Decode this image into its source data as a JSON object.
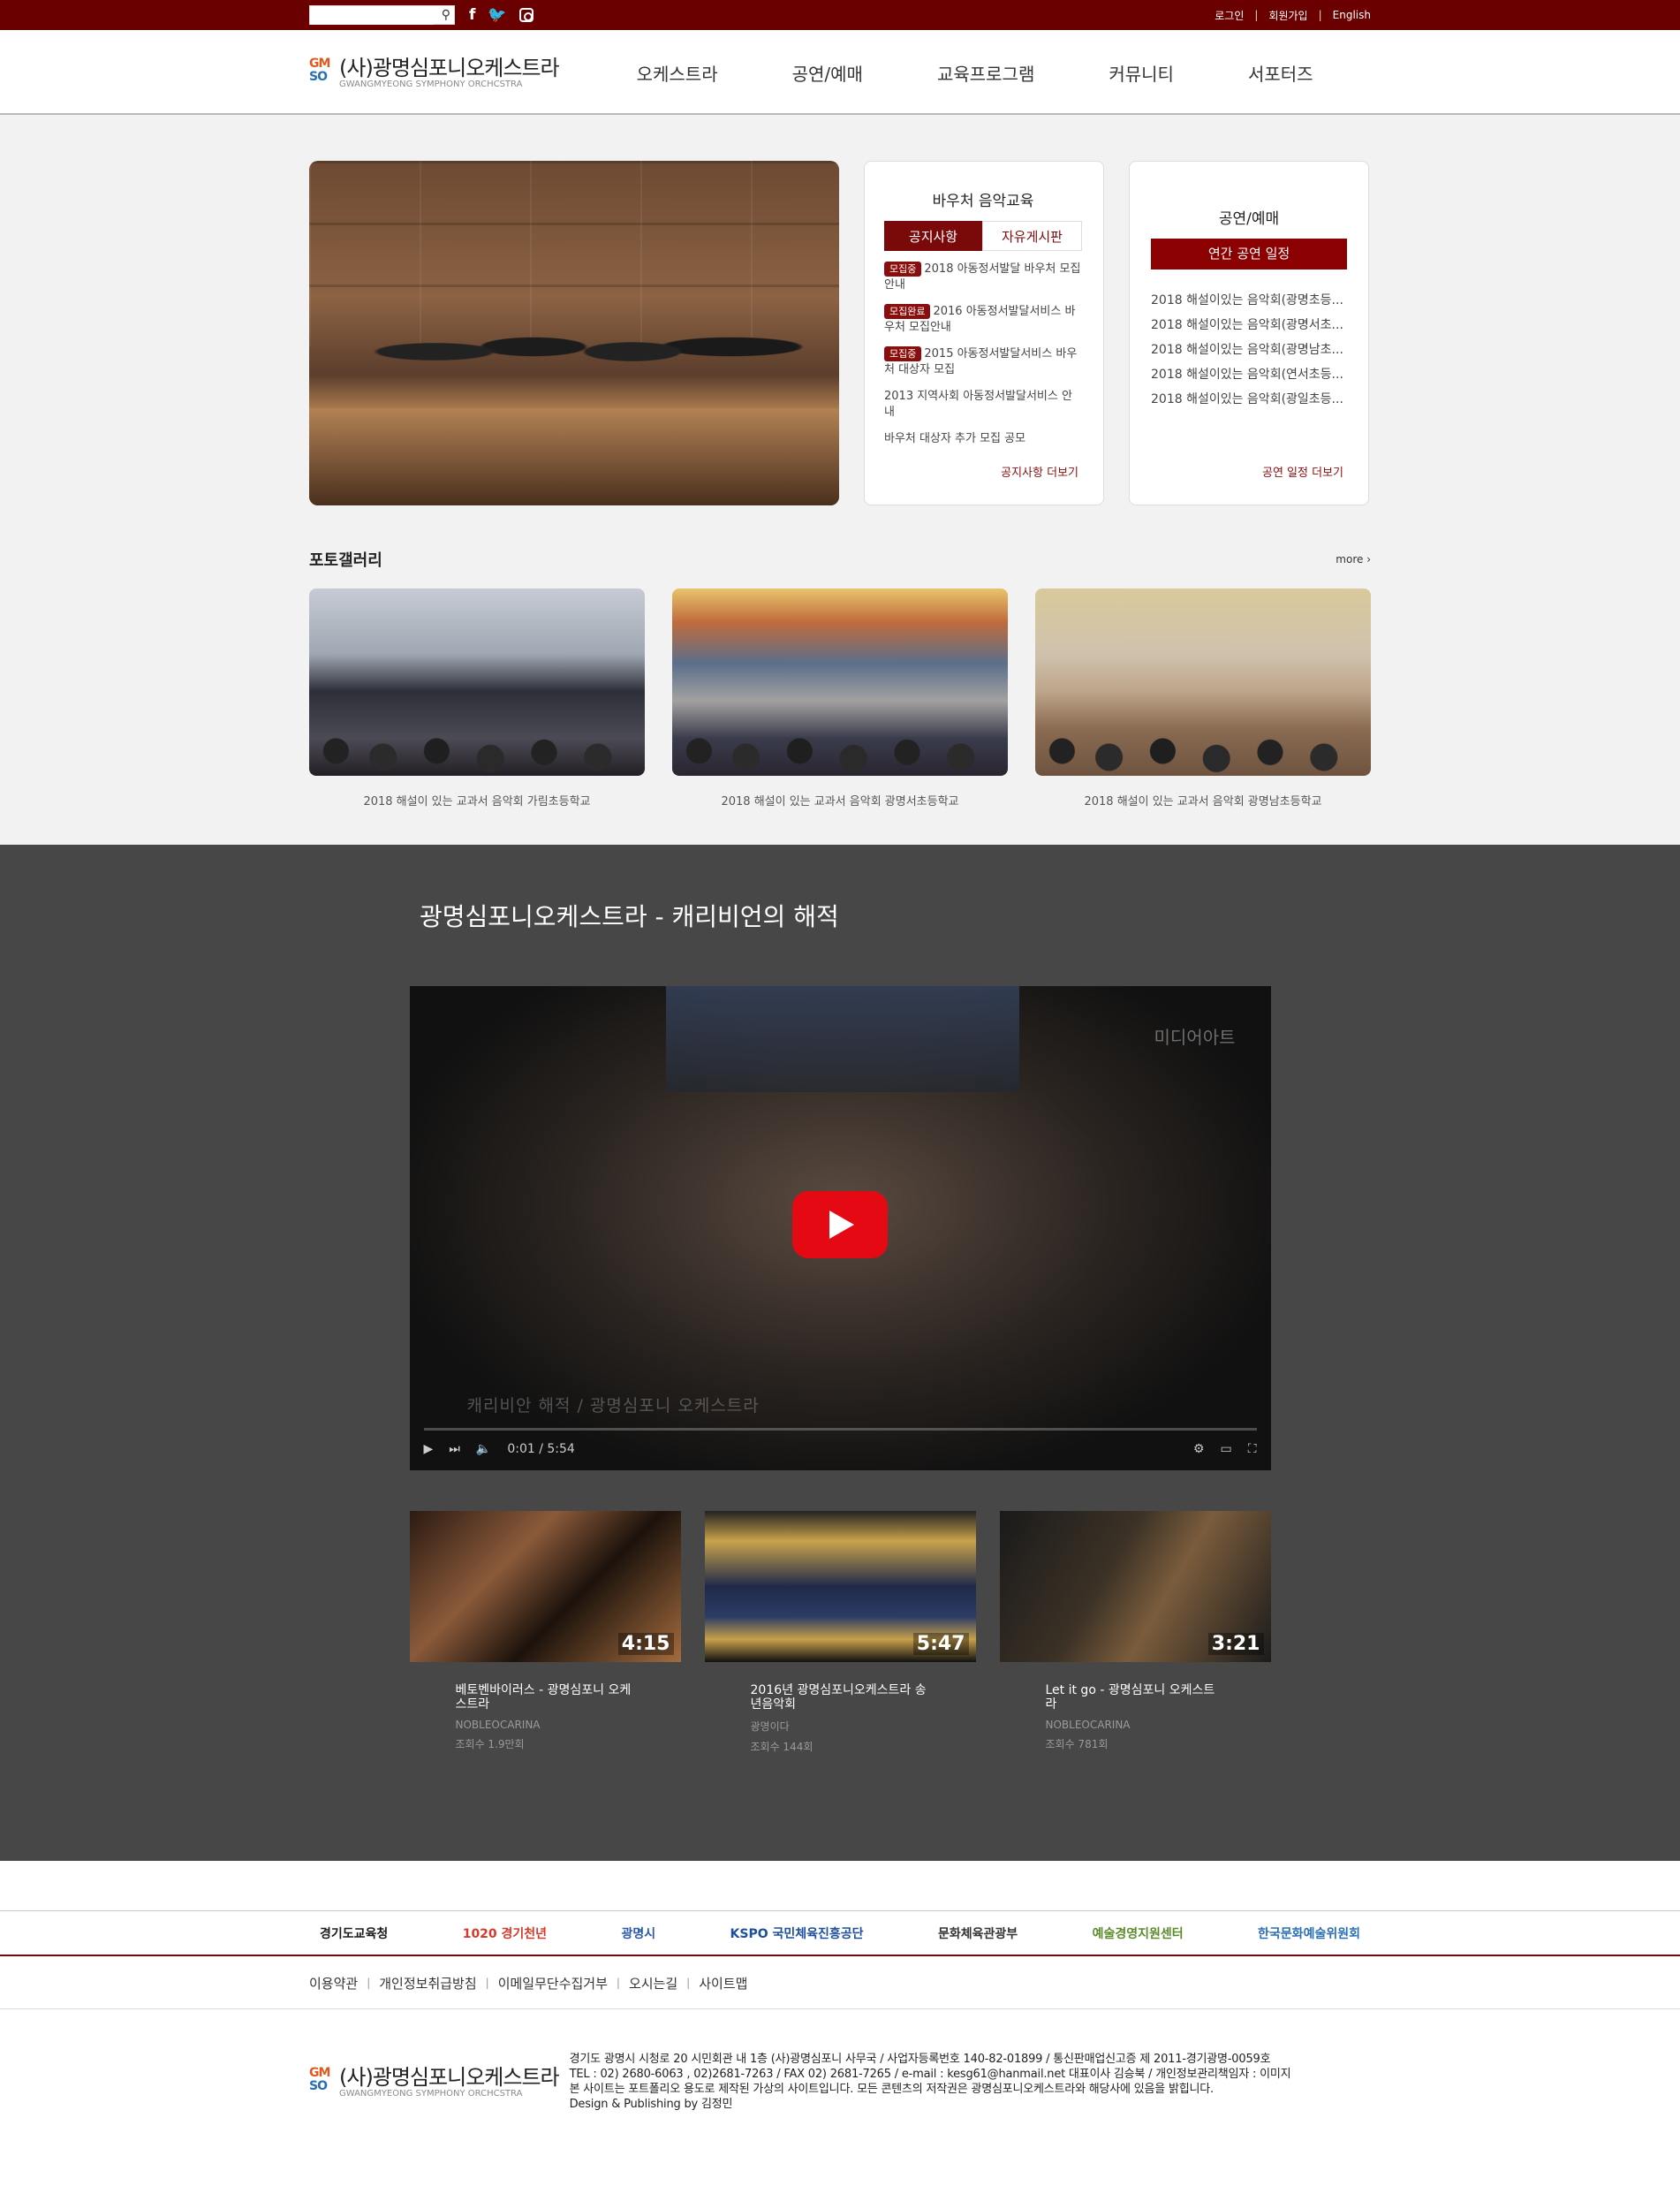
{
  "topbar": {
    "search_placeholder": "",
    "sns": {
      "facebook": "f",
      "twitter": "t"
    },
    "util": {
      "login": "로그인",
      "signup": "회원가입",
      "english": "English",
      "sep": "|"
    }
  },
  "header": {
    "logo_mark_top": "GM",
    "logo_mark_bottom": "SO",
    "logo_ko": "(사)광명심포니오케스트라",
    "logo_en": "GWANGMYEONG SYMPHONY ORCHCSTRA",
    "nav": [
      "오케스트라",
      "공연/예매",
      "교육프로그램",
      "커뮤니티",
      "서포터즈"
    ]
  },
  "notice": {
    "title": "바우처 음악교육",
    "tab_on": "공지사항",
    "tab_off": "자유게시판",
    "items": [
      {
        "badge": "모집중",
        "text": "2018 아동정서발달 바우처 모집안내"
      },
      {
        "badge": "모집완료",
        "text": "2016 아동정서발달서비스 바우처 모집안내"
      },
      {
        "badge": "모집중",
        "text": "2015 아동정서발달서비스 바우처 대상자 모집"
      },
      {
        "badge": "",
        "text": "2013  지역사회 아동정서발달서비스 안내"
      },
      {
        "badge": "",
        "text": "바우처 대상자 추가 모집 공모"
      }
    ],
    "more": "공지사항 더보기"
  },
  "performance": {
    "title": "공연/예매",
    "calendar_button": "연간 공연 일정",
    "items": [
      "2018 해설이있는 음악회(광명초등...",
      "2018 해설이있는 음악회(광명서초...",
      "2018 해설이있는 음악회(광명남초...",
      "2018 해설이있는 음악회(연서초등...",
      "2018 해설이있는 음악회(광일초등..."
    ],
    "more": "공연 일정 더보기"
  },
  "gallery": {
    "title": "포토갤러리",
    "more": "more ›",
    "items": [
      {
        "caption": "2018 해설이 있는 교과서 음악회 가림초등학교"
      },
      {
        "caption": "2018 해설이 있는 교과서 음악회 광명서초등학교"
      },
      {
        "caption": "2018 해설이 있는 교과서 음악회 광명남초등학교"
      }
    ]
  },
  "video": {
    "title": "광명심포니오케스트라 - 캐리비언의 해적",
    "watermark": "미디어아트",
    "overlay_caption": "캐리비안 해적 / 광명심포니 오케스트라",
    "time": "0:01 / 5:54",
    "list": [
      {
        "duration": "4:15",
        "title": "베토벤바이러스 - 광명심포니 오케스트라",
        "channel": "NOBLEOCARINA",
        "views": "조회수 1.9만회"
      },
      {
        "duration": "5:47",
        "title": "2016년 광명심포니오케스트라 송년음악회",
        "channel": "광명이다",
        "views": "조회수 144회"
      },
      {
        "duration": "3:21",
        "title": "Let it go - 광명심포니 오케스트라",
        "channel": "NOBLEOCARINA",
        "views": "조회수 781회"
      }
    ]
  },
  "partners": [
    {
      "name": "경기도교육청",
      "color": "#1a1a1a"
    },
    {
      "name": "1020 경기천년",
      "color": "#d83a2a"
    },
    {
      "name": "광명시",
      "color": "#2a5aa8"
    },
    {
      "name": "KSPO 국민체육진흥공단",
      "color": "#1d4f9e"
    },
    {
      "name": "문화체육관광부",
      "color": "#333333"
    },
    {
      "name": "예술경영지원센터",
      "color": "#5a8a2a"
    },
    {
      "name": "한국문화예술위원회",
      "color": "#2a6fb5"
    }
  ],
  "footer_nav": [
    "이용약관",
    "개인정보취급방침",
    "이메일무단수집거부",
    "오시는길",
    "사이트맵"
  ],
  "footer_info": {
    "line1": "경기도 광명시 시청로 20 시민회관 내 1층 (사)광명심포니 사무국 / 사업자등록번호 140-82-01899 / 통신판매업신고증 제 2011-경기광명-0059호",
    "line2": "TEL : 02) 2680-6063 , 02)2681-7263 / FAX 02) 2681-7265 / e-mail : kesg61@hanmail.net 대표이사 김승북 / 개인정보관리책임자 : 이미지",
    "line3": "본 사이트는 포트폴리오 용도로 제작된 가상의 사이트입니다.  모든 콘텐츠의 저작권은 광명심포니오케스트라와 해당사에 있음을 밝힙니다.",
    "line4": "Design & Publishing by 김정민"
  }
}
